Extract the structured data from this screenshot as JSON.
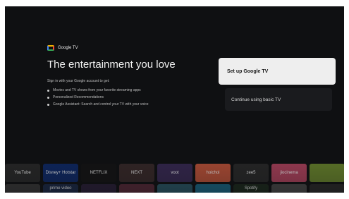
{
  "brand": {
    "name": "Google TV",
    "icon": "google-tv-logo-icon"
  },
  "headline": "The entertainment you love",
  "intro": "Sign in with your Google account to get:",
  "bullets": [
    "Movies and TV shows from your favorite streaming apps",
    "Personalized Recommendations",
    "Google Assistant: Search and control your TV with your voice"
  ],
  "actions": {
    "primary": "Set up Google TV",
    "secondary": "Continue using basic TV"
  },
  "apps_row1": [
    {
      "label": "YouTube",
      "color": "#2a2a2a"
    },
    {
      "label": "Disney+ Hotstar",
      "color": "#0d2a6b"
    },
    {
      "label": "NETFLIX",
      "color": "#141414"
    },
    {
      "label": "NEXT",
      "color": "#3a2a2a"
    },
    {
      "label": "voot",
      "color": "#3a2a56"
    },
    {
      "label": "hoichoi",
      "color": "#c4553b"
    },
    {
      "label": "zee5",
      "color": "#2a2a2a"
    },
    {
      "label": "jiocinema",
      "color": "#b64560"
    },
    {
      "label": "",
      "color": "#6d8a2e"
    }
  ],
  "apps_row2": [
    {
      "label": "",
      "color": "#3a3a3a"
    },
    {
      "label": "prime video",
      "color": "#1b2a4a"
    },
    {
      "label": "",
      "color": "#2a1f3a"
    },
    {
      "label": "",
      "color": "#5a2a3a"
    },
    {
      "label": "",
      "color": "#2a5a6a"
    },
    {
      "label": "",
      "color": "#1a6a8a"
    },
    {
      "label": "Spotify",
      "color": "#1c2a1c"
    },
    {
      "label": "",
      "color": "#4a4a4a"
    },
    {
      "label": "",
      "color": "#2a2a2a"
    }
  ]
}
